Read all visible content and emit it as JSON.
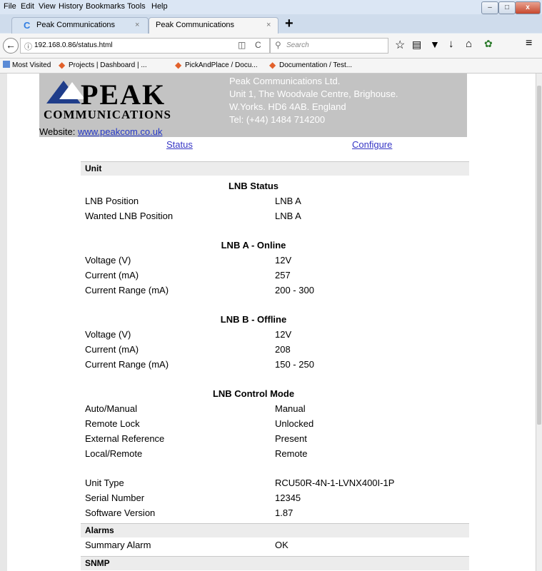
{
  "browser": {
    "menu": [
      "File",
      "Edit",
      "View",
      "History",
      "Bookmarks",
      "Tools",
      "Help"
    ],
    "tabs": [
      {
        "label": "Peak Communications",
        "active": false
      },
      {
        "label": "Peak Communications",
        "active": true
      }
    ],
    "address": "192.168.0.86/status.html",
    "search_placeholder": "Search",
    "bookmarks": [
      "Most Visited",
      "Projects | Dashboard | ...",
      "PickAndPlace / Docu...",
      "Documentation / Test..."
    ]
  },
  "site": {
    "logo_top": "PEAK",
    "logo_bottom": "COMMUNICATIONS",
    "address_lines": [
      "Peak Communications Ltd.",
      "Unit 1, The Woodvale Centre, Brighouse.",
      "W.Yorks. HD6 4AB. England",
      "Tel: (+44) 1484 714200"
    ],
    "website_label": "Website:",
    "website_link": "www.peakcom.co.uk",
    "nav": {
      "status": "Status",
      "configure": "Configure"
    }
  },
  "status": {
    "unit_header": "Unit",
    "lnb_status": {
      "title": "LNB Status",
      "rows": [
        {
          "label": "LNB Position",
          "value": "LNB A"
        },
        {
          "label": "Wanted LNB Position",
          "value": "LNB A"
        }
      ]
    },
    "lnb_a": {
      "title": "LNB A - Online",
      "rows": [
        {
          "label": "Voltage (V)",
          "value": "12V"
        },
        {
          "label": "Current (mA)",
          "value": "257"
        },
        {
          "label": "Current Range (mA)",
          "value": "200 - 300"
        }
      ]
    },
    "lnb_b": {
      "title": "LNB B - Offline",
      "rows": [
        {
          "label": "Voltage (V)",
          "value": "12V"
        },
        {
          "label": "Current (mA)",
          "value": "208"
        },
        {
          "label": "Current Range (mA)",
          "value": "150 - 250"
        }
      ]
    },
    "control_mode": {
      "title": "LNB Control Mode",
      "rows": [
        {
          "label": "Auto/Manual",
          "value": "Manual"
        },
        {
          "label": "Remote Lock",
          "value": "Unlocked"
        },
        {
          "label": "External Reference",
          "value": "Present"
        },
        {
          "label": "Local/Remote",
          "value": "Remote"
        }
      ]
    },
    "unit_info": {
      "rows": [
        {
          "label": "Unit Type",
          "value": "RCU50R-4N-1-LVNX400I-1P"
        },
        {
          "label": "Serial Number",
          "value": "12345"
        },
        {
          "label": "Software Version",
          "value": "1.87"
        }
      ]
    },
    "alarms_header": "Alarms",
    "alarms": [
      {
        "label": "Summary Alarm",
        "value": "OK"
      }
    ],
    "snmp_header": "SNMP"
  }
}
